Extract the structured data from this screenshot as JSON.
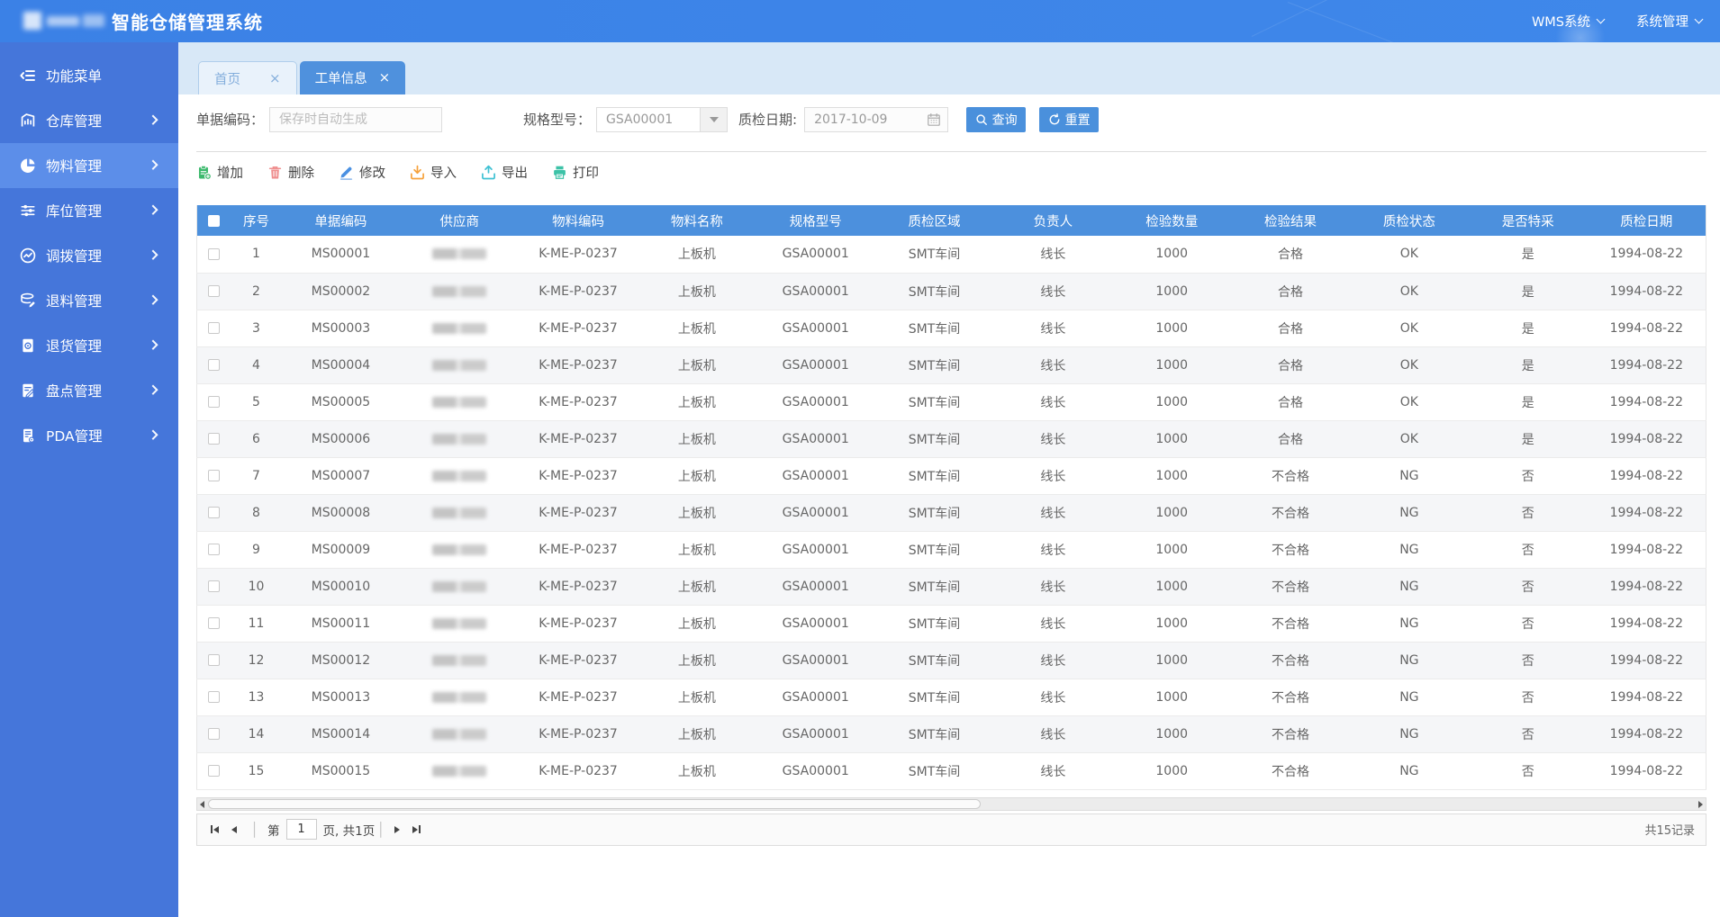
{
  "app": {
    "title": "智能仓储管理系统"
  },
  "header": {
    "menus": [
      {
        "id": "wms",
        "label": "WMS系统"
      },
      {
        "id": "system",
        "label": "系统管理"
      }
    ]
  },
  "sidebar": {
    "items": [
      {
        "id": "function-menu",
        "label": "功能菜单",
        "icon": "menu-icon",
        "chevron": false,
        "active": false
      },
      {
        "id": "warehouse",
        "label": "仓库管理",
        "icon": "warehouse-icon",
        "chevron": true,
        "active": false
      },
      {
        "id": "material",
        "label": "物料管理",
        "icon": "pie-chart-icon",
        "chevron": true,
        "active": true
      },
      {
        "id": "location",
        "label": "库位管理",
        "icon": "sliders-icon",
        "chevron": true,
        "active": false
      },
      {
        "id": "transfer",
        "label": "调拨管理",
        "icon": "transfer-icon",
        "chevron": true,
        "active": false
      },
      {
        "id": "material-return",
        "label": "退料管理",
        "icon": "database-icon",
        "chevron": true,
        "active": false
      },
      {
        "id": "goods-return",
        "label": "退货管理",
        "icon": "return-doc-icon",
        "chevron": true,
        "active": false
      },
      {
        "id": "stocktake",
        "label": "盘点管理",
        "icon": "checklist-icon",
        "chevron": true,
        "active": false
      },
      {
        "id": "pda",
        "label": "PDA管理",
        "icon": "pda-icon",
        "chevron": true,
        "active": false
      }
    ]
  },
  "tabs": [
    {
      "id": "home",
      "label": "首页",
      "active": false
    },
    {
      "id": "work-order",
      "label": "工单信息",
      "active": true
    }
  ],
  "filters": {
    "doc_code": {
      "label": "单据编码：",
      "placeholder": "保存时自动生成"
    },
    "spec": {
      "label": "规格型号：",
      "value": "GSA00001"
    },
    "date": {
      "label": "质检日期:",
      "value": "2017-10-09"
    },
    "search_label": "查询",
    "reset_label": "重置"
  },
  "toolbar": [
    {
      "id": "add",
      "label": "增加",
      "icon": "add-icon",
      "color": "#3cb96d"
    },
    {
      "id": "delete",
      "label": "删除",
      "icon": "delete-icon",
      "color": "#ef8d8d"
    },
    {
      "id": "edit",
      "label": "修改",
      "icon": "edit-icon",
      "color": "#4a90e2"
    },
    {
      "id": "import",
      "label": "导入",
      "icon": "import-icon",
      "color": "#f6a23c"
    },
    {
      "id": "export",
      "label": "导出",
      "icon": "export-icon",
      "color": "#3ec1d3"
    },
    {
      "id": "print",
      "label": "打印",
      "icon": "print-icon",
      "color": "#3cc2a7"
    }
  ],
  "table": {
    "columns": [
      "序号",
      "单据编码",
      "供应商",
      "物料编码",
      "物料名称",
      "规格型号",
      "质检区域",
      "负责人",
      "检验数量",
      "检验结果",
      "质检状态",
      "是否特采",
      "质检日期"
    ],
    "supplier_column_blurred": true,
    "rows": [
      [
        "1",
        "MS00001",
        null,
        "K-ME-P-0237",
        "上板机",
        "GSA00001",
        "SMT车间",
        "线长",
        "1000",
        "合格",
        "OK",
        "是",
        "1994-08-22"
      ],
      [
        "2",
        "MS00002",
        null,
        "K-ME-P-0237",
        "上板机",
        "GSA00001",
        "SMT车间",
        "线长",
        "1000",
        "合格",
        "OK",
        "是",
        "1994-08-22"
      ],
      [
        "3",
        "MS00003",
        null,
        "K-ME-P-0237",
        "上板机",
        "GSA00001",
        "SMT车间",
        "线长",
        "1000",
        "合格",
        "OK",
        "是",
        "1994-08-22"
      ],
      [
        "4",
        "MS00004",
        null,
        "K-ME-P-0237",
        "上板机",
        "GSA00001",
        "SMT车间",
        "线长",
        "1000",
        "合格",
        "OK",
        "是",
        "1994-08-22"
      ],
      [
        "5",
        "MS00005",
        null,
        "K-ME-P-0237",
        "上板机",
        "GSA00001",
        "SMT车间",
        "线长",
        "1000",
        "合格",
        "OK",
        "是",
        "1994-08-22"
      ],
      [
        "6",
        "MS00006",
        null,
        "K-ME-P-0237",
        "上板机",
        "GSA00001",
        "SMT车间",
        "线长",
        "1000",
        "合格",
        "OK",
        "是",
        "1994-08-22"
      ],
      [
        "7",
        "MS00007",
        null,
        "K-ME-P-0237",
        "上板机",
        "GSA00001",
        "SMT车间",
        "线长",
        "1000",
        "不合格",
        "NG",
        "否",
        "1994-08-22"
      ],
      [
        "8",
        "MS00008",
        null,
        "K-ME-P-0237",
        "上板机",
        "GSA00001",
        "SMT车间",
        "线长",
        "1000",
        "不合格",
        "NG",
        "否",
        "1994-08-22"
      ],
      [
        "9",
        "MS00009",
        null,
        "K-ME-P-0237",
        "上板机",
        "GSA00001",
        "SMT车间",
        "线长",
        "1000",
        "不合格",
        "NG",
        "否",
        "1994-08-22"
      ],
      [
        "10",
        "MS00010",
        null,
        "K-ME-P-0237",
        "上板机",
        "GSA00001",
        "SMT车间",
        "线长",
        "1000",
        "不合格",
        "NG",
        "否",
        "1994-08-22"
      ],
      [
        "11",
        "MS00011",
        null,
        "K-ME-P-0237",
        "上板机",
        "GSA00001",
        "SMT车间",
        "线长",
        "1000",
        "不合格",
        "NG",
        "否",
        "1994-08-22"
      ],
      [
        "12",
        "MS00012",
        null,
        "K-ME-P-0237",
        "上板机",
        "GSA00001",
        "SMT车间",
        "线长",
        "1000",
        "不合格",
        "NG",
        "否",
        "1994-08-22"
      ],
      [
        "13",
        "MS00013",
        null,
        "K-ME-P-0237",
        "上板机",
        "GSA00001",
        "SMT车间",
        "线长",
        "1000",
        "不合格",
        "NG",
        "否",
        "1994-08-22"
      ],
      [
        "14",
        "MS00014",
        null,
        "K-ME-P-0237",
        "上板机",
        "GSA00001",
        "SMT车间",
        "线长",
        "1000",
        "不合格",
        "NG",
        "否",
        "1994-08-22"
      ],
      [
        "15",
        "MS00015",
        null,
        "K-ME-P-0237",
        "上板机",
        "GSA00001",
        "SMT车间",
        "线长",
        "1000",
        "不合格",
        "NG",
        "否",
        "1994-08-22"
      ]
    ]
  },
  "pagination": {
    "page_prefix": "第",
    "page_value": "1",
    "page_suffix": "页, 共1页",
    "total_label": "共15记录"
  }
}
